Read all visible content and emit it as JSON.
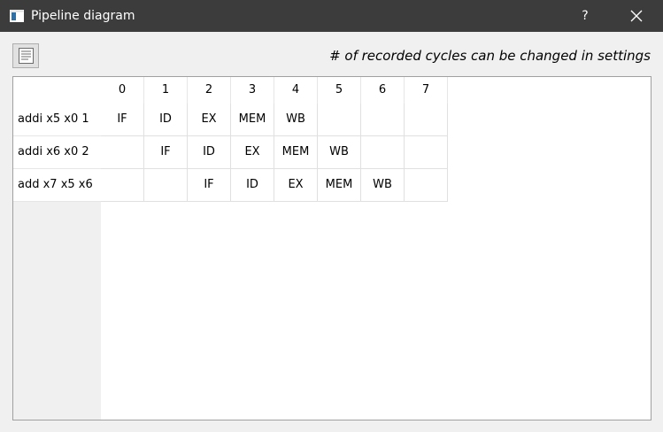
{
  "window": {
    "title": "Pipeline diagram",
    "help_label": "?",
    "app_icon": "window-app-icon",
    "close_icon": "close-icon"
  },
  "toolbar": {
    "button_icon": "document-list-icon",
    "hint": "# of recorded cycles can be changed in settings"
  },
  "table": {
    "columns": [
      "0",
      "1",
      "2",
      "3",
      "4",
      "5",
      "6",
      "7"
    ],
    "rows": [
      {
        "label": "addi x5 x0 1",
        "cells": [
          "IF",
          "ID",
          "EX",
          "MEM",
          "WB",
          "",
          "",
          ""
        ]
      },
      {
        "label": "addi x6 x0 2",
        "cells": [
          "",
          "IF",
          "ID",
          "EX",
          "MEM",
          "WB",
          "",
          ""
        ]
      },
      {
        "label": "add x7 x5 x6",
        "cells": [
          "",
          "",
          "IF",
          "ID",
          "EX",
          "MEM",
          "WB",
          ""
        ]
      }
    ]
  },
  "colors": {
    "titlebar": "#3c3c3c",
    "background": "#f0f0f0",
    "grid": "#e0e0e0"
  }
}
